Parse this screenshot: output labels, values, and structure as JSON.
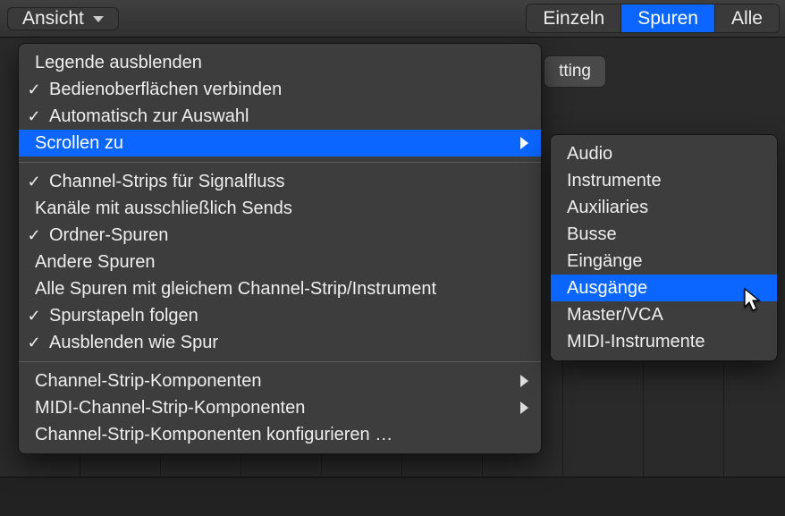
{
  "toolbar": {
    "view_button_label": "Ansicht",
    "seg": {
      "single": "Einzeln",
      "tracks": "Spuren",
      "all": "Alle"
    }
  },
  "background": {
    "setting_chip_partial": "tting"
  },
  "menu": {
    "group1": [
      {
        "label": "Legende ausblenden",
        "checked": false,
        "submenu": false,
        "hl": false
      },
      {
        "label": "Bedienoberflächen verbinden",
        "checked": true,
        "submenu": false,
        "hl": false
      },
      {
        "label": "Automatisch zur Auswahl",
        "checked": true,
        "submenu": false,
        "hl": false
      },
      {
        "label": "Scrollen zu",
        "checked": false,
        "submenu": true,
        "hl": true
      }
    ],
    "group2": [
      {
        "label": "Channel-Strips für Signalfluss",
        "checked": true,
        "submenu": false
      },
      {
        "label": "Kanäle mit ausschließlich Sends",
        "checked": false,
        "submenu": false
      },
      {
        "label": "Ordner-Spuren",
        "checked": true,
        "submenu": false
      },
      {
        "label": "Andere Spuren",
        "checked": false,
        "submenu": false
      },
      {
        "label": "Alle Spuren mit gleichem Channel-Strip/Instrument",
        "checked": false,
        "submenu": false
      },
      {
        "label": "Spurstapeln folgen",
        "checked": true,
        "submenu": false
      },
      {
        "label": "Ausblenden wie Spur",
        "checked": true,
        "submenu": false
      }
    ],
    "group3": [
      {
        "label": "Channel-Strip-Komponenten",
        "checked": false,
        "submenu": true
      },
      {
        "label": "MIDI-Channel-Strip-Komponenten",
        "checked": false,
        "submenu": true
      },
      {
        "label": "Channel-Strip-Komponenten konfigurieren …",
        "checked": false,
        "submenu": false
      }
    ]
  },
  "submenu": {
    "items": [
      {
        "label": "Audio",
        "hl": false
      },
      {
        "label": "Instrumente",
        "hl": false
      },
      {
        "label": "Auxiliaries",
        "hl": false
      },
      {
        "label": "Busse",
        "hl": false
      },
      {
        "label": "Eingänge",
        "hl": false
      },
      {
        "label": "Ausgänge",
        "hl": true
      },
      {
        "label": "Master/VCA",
        "hl": false
      },
      {
        "label": "MIDI-Instrumente",
        "hl": false
      }
    ]
  }
}
